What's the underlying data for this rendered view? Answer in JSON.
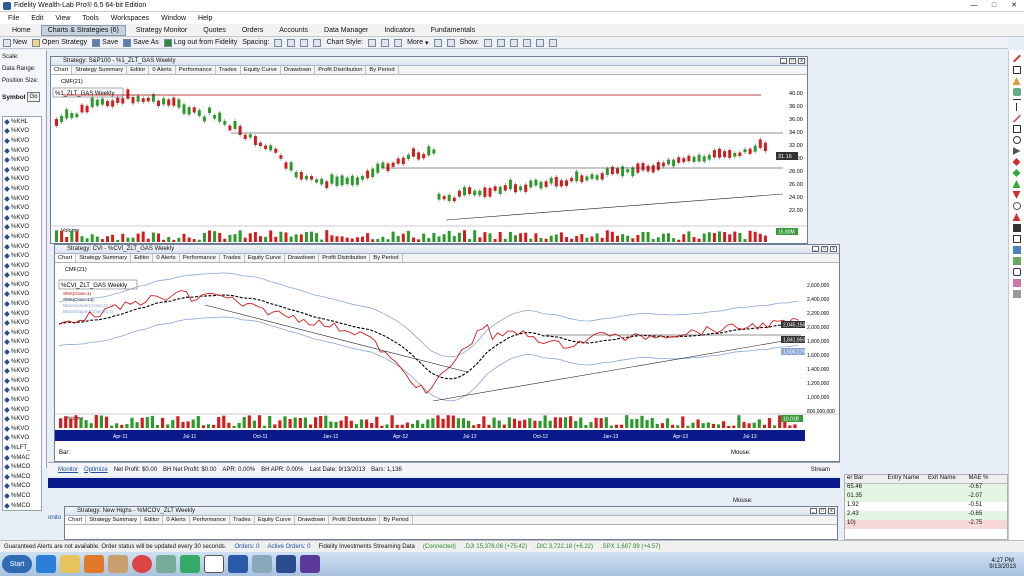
{
  "window": {
    "title": "Fidelity Wealth-Lab Pro® 6.5   64-bit Edition",
    "min": "—",
    "max": "□",
    "close": "✕"
  },
  "menu": [
    "File",
    "Edit",
    "View",
    "Tools",
    "Workspaces",
    "Window",
    "Help"
  ],
  "nav": {
    "tabs": [
      "Home",
      "Charts & Strategies (6)",
      "Strategy Monitor",
      "Quotes",
      "Orders",
      "Accounts",
      "Data Manager",
      "Indicators",
      "Fundamentals"
    ],
    "active": "Charts & Strategies (6)"
  },
  "toolbar": {
    "new": "New",
    "open": "Open Strategy",
    "save": "Save",
    "save_as": "Save As",
    "logout": "Log out from Fidelity",
    "spacing": "Spacing:",
    "chart_style": "Chart Style:",
    "more": "More",
    "show": "Show:"
  },
  "left": {
    "scale": "Scale:",
    "data_range": "Data Range:",
    "position_size": "Position Size:",
    "symbol": "Symbol",
    "go": "Go",
    "symbols": [
      "%KHL",
      "%KVO",
      "%KVO",
      "%KVO",
      "%KVO",
      "%KVO",
      "%KVO",
      "%KVO",
      "%KVO",
      "%KVO",
      "%KVO",
      "%KVO",
      "%KVO",
      "%KVO",
      "%KVO",
      "%KVO",
      "%KVO",
      "%KVO",
      "%KVO",
      "%KVO",
      "%KVO",
      "%KVO",
      "%KVO",
      "%KVO",
      "%KVO",
      "%KVO",
      "%KVO",
      "%KVO",
      "%KVO",
      "%KVO",
      "%KVO",
      "%KVO",
      "%KVO",
      "%KVO",
      "%LFT_",
      "%MAC",
      "%MCO",
      "%MCO",
      "%MCO",
      "%MCO",
      "%MCO"
    ]
  },
  "win1": {
    "title": "Strategy: S&P100 - %1_ZLT_GAS Weekly",
    "tabs": [
      "Chart",
      "Strategy Summary",
      "Editor",
      "0 Alerts",
      "Performance",
      "Trades",
      "Equity Curve",
      "Drawdown",
      "Profit Distribution",
      "By Period"
    ],
    "indicator": "CMF(21)",
    "symbol_label": "%1_ZLT_GAS Weekly",
    "price_labels": [
      "40.00",
      "38.00",
      "36.00",
      "34.00",
      "32.00",
      "30.00",
      "28.00",
      "26.00",
      "24.00",
      "22.00"
    ],
    "last_price": "31.16",
    "volume_label": "Volume",
    "volume_value": "15.80M"
  },
  "win2": {
    "title": "Strategy: CVI - %CVI_ZLT_GAS Weekly",
    "tabs": [
      "Chart",
      "Strategy Summary",
      "Editor",
      "0 Alerts",
      "Performance",
      "Trades",
      "Equity Curve",
      "Drawdown",
      "Profit Distribution",
      "By Period"
    ],
    "indicator": "CMF(21)",
    "symbol_label": "%CVI_ZLT_GAS Weekly",
    "legend": [
      "SMA(Close,1)",
      "SMA(Close,13)",
      "BBandLower(Close,20,2)",
      "BBandUpper(Close,20,2)"
    ],
    "price_labels": [
      "2,600,000",
      "2,400,000",
      "2,200,000",
      "2,000,000",
      "1,800,000",
      "1,600,000",
      "1,400,000",
      "1,200,000",
      "1,000,000",
      "800,000,000"
    ],
    "box_labels": [
      "2,045,156",
      "1,841,950",
      "1,500,179"
    ],
    "volume_label": "Volume",
    "volume_value": "10.01B",
    "dates": [
      "Apr-11",
      "Jul-11",
      "Oct-11",
      "Jan-12",
      "Apr-12",
      "Jul-12",
      "Oct-12",
      "Jan-13",
      "Apr-13",
      "Jul-13"
    ]
  },
  "win3": {
    "title": "Strategy: New Highs - %MCOV_ZLT Weekly",
    "tabs": [
      "Chart",
      "Strategy Summary",
      "Editor",
      "0 Alerts",
      "Performance",
      "Trades",
      "Equity Curve",
      "Drawdown",
      "Profit Distribution",
      "By Period"
    ]
  },
  "bottom": {
    "bar": "Bar:",
    "mouse": "Mouse:",
    "monitor": "Monitor",
    "optimize": "Optimize",
    "net_profit": "Net Profit: $0.00",
    "bh_net_profit": "BH Net Profit: $0.00",
    "apr": "APR: 0.00%",
    "bh_apr": "BH APR: 0.00%",
    "last_date": "Last Date: 9/13/2013",
    "bars": "Bars: 1,136",
    "stream": "Stream",
    "mouse2": "Mouse:",
    "monito": "onito"
  },
  "trades": {
    "headers": [
      "er Bar",
      "Entry Name",
      "Exit Name",
      "MAE %"
    ],
    "rows": [
      {
        "c1": "65.46",
        "c4": "-0.67"
      },
      {
        "c1": "01.35",
        "c4": "-2.07"
      },
      {
        "c1": "1.92",
        "c4": "-0.51"
      },
      {
        "c1": "2.43",
        "c4": "-0.65"
      },
      {
        "c1": "10)",
        "c4": "-2.75"
      }
    ]
  },
  "status": {
    "guaranteed": "Guaranteed Alerts are not available. Order status will be updated every 30 seconds.",
    "orders": "Orders: 0",
    "active_orders": "Active Orders: 0",
    "streaming": "Fidelity Investments Streaming Data",
    "connected": "(Connected)",
    "dji": ".DJI 15,376.06 (+75.42)",
    "dic": ".DIC 3,722.18 (+6.22)",
    "spx": ".SPX 1,687.99 (+4.57)"
  },
  "taskbar": {
    "start": "Start",
    "time": "4:27 PM",
    "date": "9/13/2013"
  }
}
